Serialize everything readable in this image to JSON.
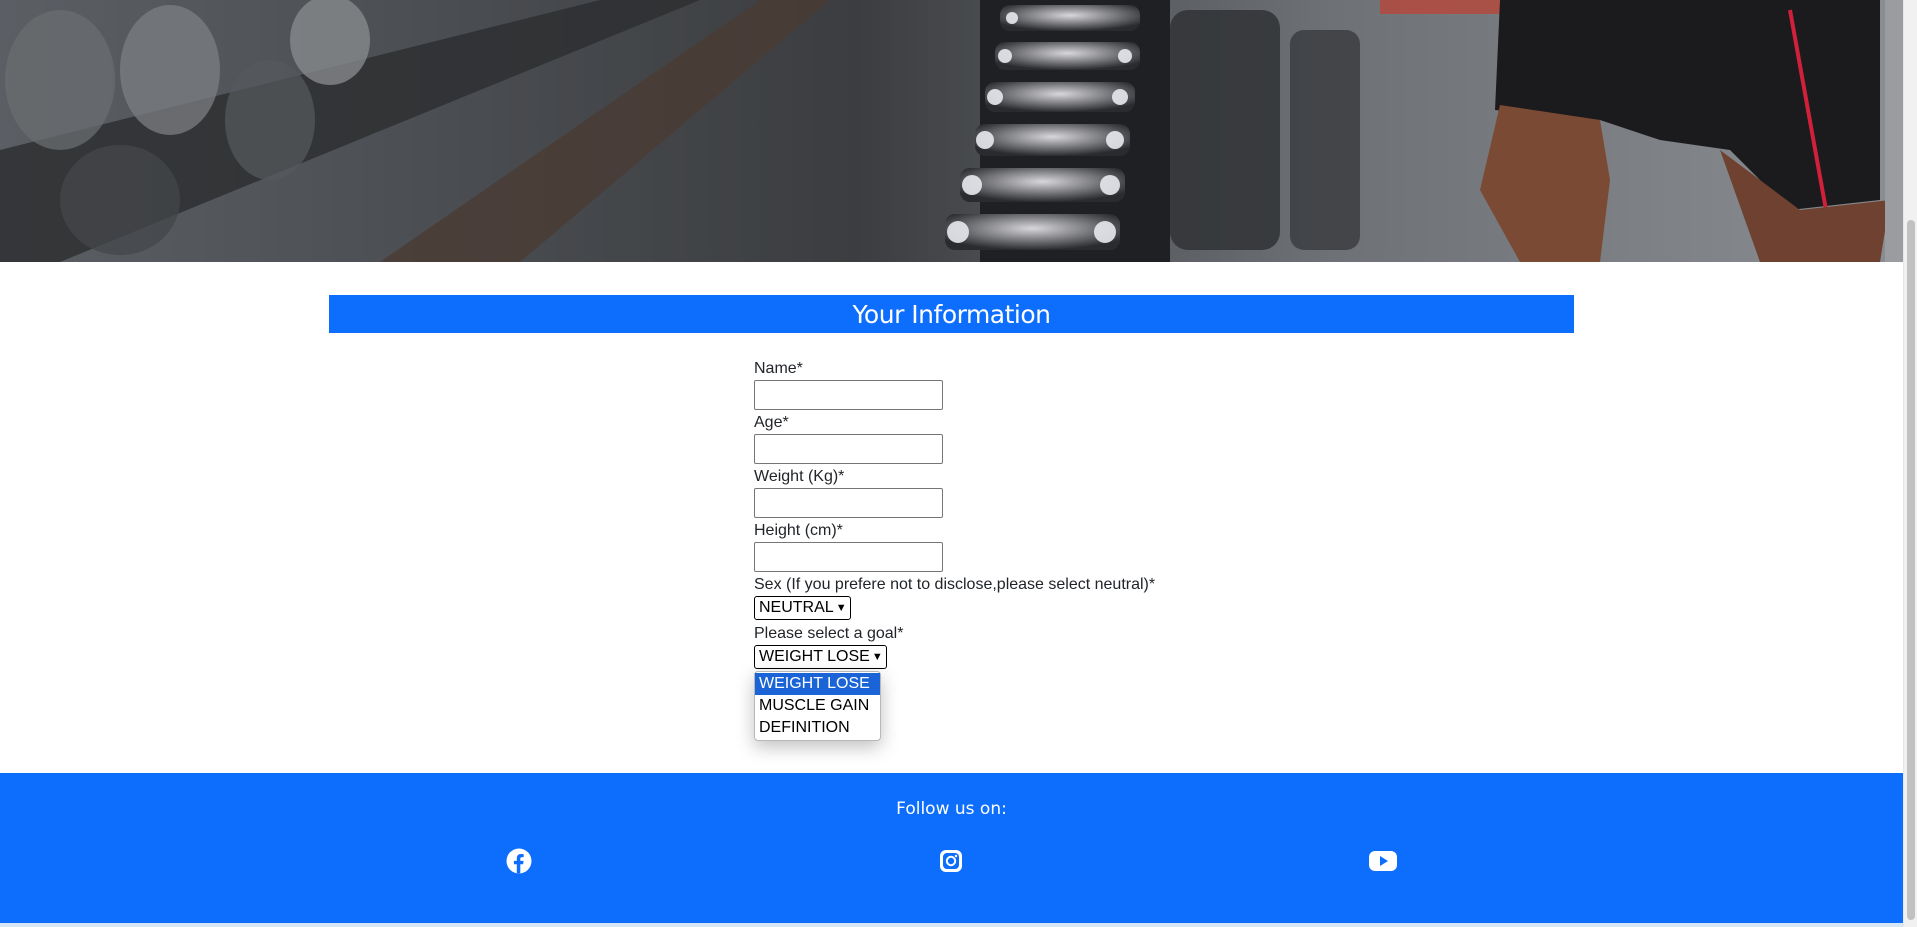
{
  "hero": {
    "image": "gym dumbbell rack photo"
  },
  "section": {
    "title": "Your Information"
  },
  "form": {
    "name_label": "Name*",
    "name_value": "",
    "age_label": "Age*",
    "age_value": "",
    "weight_label": "Weight (Kg)*",
    "weight_value": "",
    "height_label": "Height (cm)*",
    "height_value": "",
    "sex_label": "Sex (If you prefere not to disclose,please select neutral)*",
    "sex_selected": "NEUTRAL",
    "goal_label": "Please select a goal*",
    "goal_selected": "WEIGHT LOSE"
  },
  "goal_dropdown": {
    "options": [
      "WEIGHT LOSE",
      "MUSCLE GAIN",
      "DEFINITION"
    ],
    "highlighted": "WEIGHT LOSE"
  },
  "footer": {
    "follow_text": "Follow us on:",
    "icons": [
      "facebook-icon",
      "instagram-icon",
      "youtube-icon"
    ]
  },
  "colors": {
    "primary": "#0d6efd",
    "option_highlight": "#1a64d8"
  }
}
